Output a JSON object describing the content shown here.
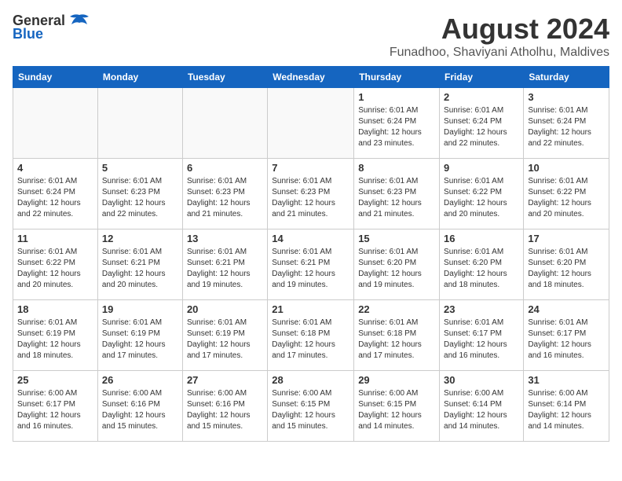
{
  "header": {
    "logo_general": "General",
    "logo_blue": "Blue",
    "month_year": "August 2024",
    "location": "Funadhoo, Shaviyani Atholhu, Maldives"
  },
  "weekdays": [
    "Sunday",
    "Monday",
    "Tuesday",
    "Wednesday",
    "Thursday",
    "Friday",
    "Saturday"
  ],
  "weeks": [
    [
      {
        "day": "",
        "sunrise": "",
        "sunset": "",
        "daylight": ""
      },
      {
        "day": "",
        "sunrise": "",
        "sunset": "",
        "daylight": ""
      },
      {
        "day": "",
        "sunrise": "",
        "sunset": "",
        "daylight": ""
      },
      {
        "day": "",
        "sunrise": "",
        "sunset": "",
        "daylight": ""
      },
      {
        "day": "1",
        "sunrise": "Sunrise: 6:01 AM",
        "sunset": "Sunset: 6:24 PM",
        "daylight": "Daylight: 12 hours and 23 minutes."
      },
      {
        "day": "2",
        "sunrise": "Sunrise: 6:01 AM",
        "sunset": "Sunset: 6:24 PM",
        "daylight": "Daylight: 12 hours and 22 minutes."
      },
      {
        "day": "3",
        "sunrise": "Sunrise: 6:01 AM",
        "sunset": "Sunset: 6:24 PM",
        "daylight": "Daylight: 12 hours and 22 minutes."
      }
    ],
    [
      {
        "day": "4",
        "sunrise": "Sunrise: 6:01 AM",
        "sunset": "Sunset: 6:24 PM",
        "daylight": "Daylight: 12 hours and 22 minutes."
      },
      {
        "day": "5",
        "sunrise": "Sunrise: 6:01 AM",
        "sunset": "Sunset: 6:23 PM",
        "daylight": "Daylight: 12 hours and 22 minutes."
      },
      {
        "day": "6",
        "sunrise": "Sunrise: 6:01 AM",
        "sunset": "Sunset: 6:23 PM",
        "daylight": "Daylight: 12 hours and 21 minutes."
      },
      {
        "day": "7",
        "sunrise": "Sunrise: 6:01 AM",
        "sunset": "Sunset: 6:23 PM",
        "daylight": "Daylight: 12 hours and 21 minutes."
      },
      {
        "day": "8",
        "sunrise": "Sunrise: 6:01 AM",
        "sunset": "Sunset: 6:23 PM",
        "daylight": "Daylight: 12 hours and 21 minutes."
      },
      {
        "day": "9",
        "sunrise": "Sunrise: 6:01 AM",
        "sunset": "Sunset: 6:22 PM",
        "daylight": "Daylight: 12 hours and 20 minutes."
      },
      {
        "day": "10",
        "sunrise": "Sunrise: 6:01 AM",
        "sunset": "Sunset: 6:22 PM",
        "daylight": "Daylight: 12 hours and 20 minutes."
      }
    ],
    [
      {
        "day": "11",
        "sunrise": "Sunrise: 6:01 AM",
        "sunset": "Sunset: 6:22 PM",
        "daylight": "Daylight: 12 hours and 20 minutes."
      },
      {
        "day": "12",
        "sunrise": "Sunrise: 6:01 AM",
        "sunset": "Sunset: 6:21 PM",
        "daylight": "Daylight: 12 hours and 20 minutes."
      },
      {
        "day": "13",
        "sunrise": "Sunrise: 6:01 AM",
        "sunset": "Sunset: 6:21 PM",
        "daylight": "Daylight: 12 hours and 19 minutes."
      },
      {
        "day": "14",
        "sunrise": "Sunrise: 6:01 AM",
        "sunset": "Sunset: 6:21 PM",
        "daylight": "Daylight: 12 hours and 19 minutes."
      },
      {
        "day": "15",
        "sunrise": "Sunrise: 6:01 AM",
        "sunset": "Sunset: 6:20 PM",
        "daylight": "Daylight: 12 hours and 19 minutes."
      },
      {
        "day": "16",
        "sunrise": "Sunrise: 6:01 AM",
        "sunset": "Sunset: 6:20 PM",
        "daylight": "Daylight: 12 hours and 18 minutes."
      },
      {
        "day": "17",
        "sunrise": "Sunrise: 6:01 AM",
        "sunset": "Sunset: 6:20 PM",
        "daylight": "Daylight: 12 hours and 18 minutes."
      }
    ],
    [
      {
        "day": "18",
        "sunrise": "Sunrise: 6:01 AM",
        "sunset": "Sunset: 6:19 PM",
        "daylight": "Daylight: 12 hours and 18 minutes."
      },
      {
        "day": "19",
        "sunrise": "Sunrise: 6:01 AM",
        "sunset": "Sunset: 6:19 PM",
        "daylight": "Daylight: 12 hours and 17 minutes."
      },
      {
        "day": "20",
        "sunrise": "Sunrise: 6:01 AM",
        "sunset": "Sunset: 6:19 PM",
        "daylight": "Daylight: 12 hours and 17 minutes."
      },
      {
        "day": "21",
        "sunrise": "Sunrise: 6:01 AM",
        "sunset": "Sunset: 6:18 PM",
        "daylight": "Daylight: 12 hours and 17 minutes."
      },
      {
        "day": "22",
        "sunrise": "Sunrise: 6:01 AM",
        "sunset": "Sunset: 6:18 PM",
        "daylight": "Daylight: 12 hours and 17 minutes."
      },
      {
        "day": "23",
        "sunrise": "Sunrise: 6:01 AM",
        "sunset": "Sunset: 6:17 PM",
        "daylight": "Daylight: 12 hours and 16 minutes."
      },
      {
        "day": "24",
        "sunrise": "Sunrise: 6:01 AM",
        "sunset": "Sunset: 6:17 PM",
        "daylight": "Daylight: 12 hours and 16 minutes."
      }
    ],
    [
      {
        "day": "25",
        "sunrise": "Sunrise: 6:00 AM",
        "sunset": "Sunset: 6:17 PM",
        "daylight": "Daylight: 12 hours and 16 minutes."
      },
      {
        "day": "26",
        "sunrise": "Sunrise: 6:00 AM",
        "sunset": "Sunset: 6:16 PM",
        "daylight": "Daylight: 12 hours and 15 minutes."
      },
      {
        "day": "27",
        "sunrise": "Sunrise: 6:00 AM",
        "sunset": "Sunset: 6:16 PM",
        "daylight": "Daylight: 12 hours and 15 minutes."
      },
      {
        "day": "28",
        "sunrise": "Sunrise: 6:00 AM",
        "sunset": "Sunset: 6:15 PM",
        "daylight": "Daylight: 12 hours and 15 minutes."
      },
      {
        "day": "29",
        "sunrise": "Sunrise: 6:00 AM",
        "sunset": "Sunset: 6:15 PM",
        "daylight": "Daylight: 12 hours and 14 minutes."
      },
      {
        "day": "30",
        "sunrise": "Sunrise: 6:00 AM",
        "sunset": "Sunset: 6:14 PM",
        "daylight": "Daylight: 12 hours and 14 minutes."
      },
      {
        "day": "31",
        "sunrise": "Sunrise: 6:00 AM",
        "sunset": "Sunset: 6:14 PM",
        "daylight": "Daylight: 12 hours and 14 minutes."
      }
    ]
  ]
}
